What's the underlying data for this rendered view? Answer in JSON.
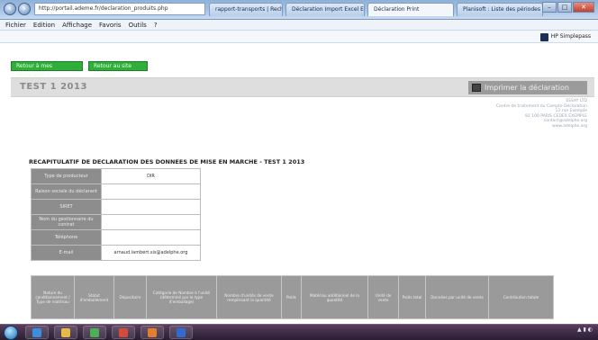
{
  "browser": {
    "address": "http://portail.ademe.fr/declaration_produits.php",
    "tabs": [
      "rapport-transports | Recherch...",
      "Déclaration Import Excel Ex...",
      "Déclaration Print",
      "Planisoft : Liste des périodes"
    ],
    "menu": [
      "Fichier",
      "Edition",
      "Affichage",
      "Favoris",
      "Outils",
      "?"
    ],
    "hp_label": "HP Simplepass"
  },
  "page": {
    "green_buttons": [
      "Retour à mes déclarations",
      "Retour au site internet"
    ],
    "title": "TEST 1 2013",
    "print_label": "Imprimer la déclaration",
    "address_lines": [
      "ESSAY LTD",
      "Centre de traitement du Compte Déclaration",
      "12 rue Exemple",
      "92 100 PARIS CEDEX EXEMPLE",
      "contact@adelphe.org",
      "www.adelphe.org"
    ],
    "recap_title": "RECAPITULATIF DE DECLARATION DES DONNEES DE MISE EN MARCHE - TEST 1 2013",
    "info_rows": [
      {
        "label": "Type de producteur",
        "value": "DIR"
      },
      {
        "label": "Raison sociale du déclarant",
        "value": ""
      },
      {
        "label": "SIRET",
        "value": ""
      },
      {
        "label": "Nom du gestionnaire du contrat",
        "value": ""
      },
      {
        "label": "Téléphone",
        "value": ""
      },
      {
        "label": "E-mail",
        "value": "arnaud.lambert.sis@adelphe.org"
      }
    ],
    "table_headers": [
      "Nature du conditionnement / Type de matériau",
      "Statut d'emballement",
      "Dépositaire",
      "Catégorie de Nombre à l'unité (déterminé par le type d'emballage)",
      "Nombre d'unités de vente remplissant la quantité",
      "Poids",
      "Matériau additionnel de la quantité",
      "Unité de vente",
      "Poids total",
      "Données par unité de vente",
      "Contribution totale"
    ]
  },
  "colors": {
    "green_button": "#2fae3a",
    "header_band": "#dedede",
    "table_label": "#8d8d8d"
  }
}
